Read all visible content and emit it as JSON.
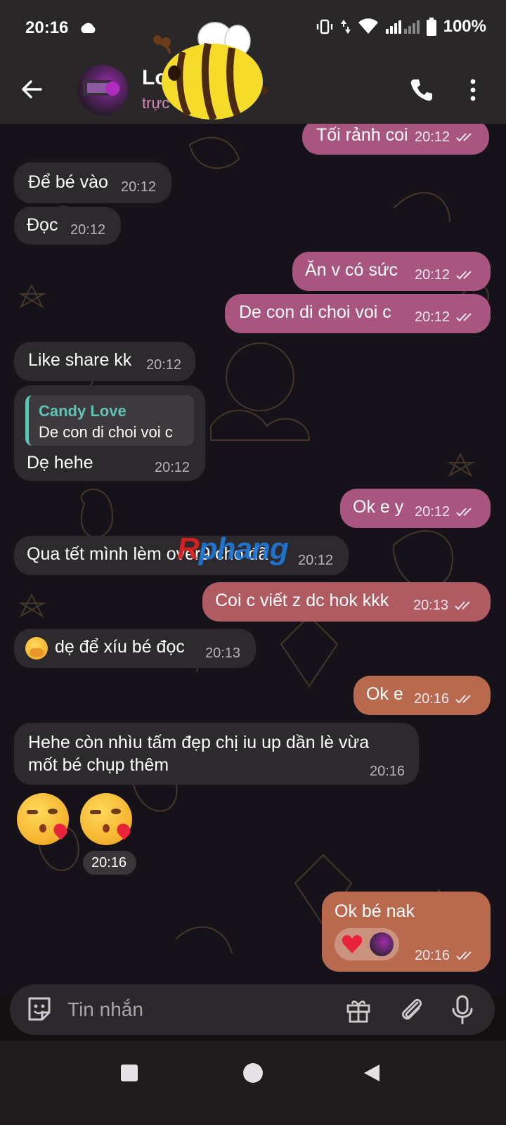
{
  "status_bar": {
    "time": "20:16",
    "battery": "100%"
  },
  "header": {
    "contact_name": "Lo          T",
    "contact_status": "trực"
  },
  "messages": [
    {
      "dir": "out",
      "text": "Tối rảnh coi",
      "time": "20:12"
    },
    {
      "dir": "in",
      "text": "Để bé vào",
      "time": "20:12"
    },
    {
      "dir": "in",
      "text": "Đọc",
      "time": "20:12"
    },
    {
      "dir": "out",
      "text": "Ăn v có sức",
      "time": "20:12"
    },
    {
      "dir": "out",
      "text": "De con di choi voi c",
      "time": "20:12"
    },
    {
      "dir": "in",
      "text": "Like share kk",
      "time": "20:12"
    },
    {
      "dir": "in",
      "reply_name": "Candy Love",
      "reply_text": "De con di choi voi c",
      "text": "Dẹ hehe",
      "time": "20:12"
    },
    {
      "dir": "out",
      "text": "Ok e y",
      "time": "20:12"
    },
    {
      "dir": "in",
      "text": "Qua tết mình lèm over9 cho đã",
      "time": "20:12"
    },
    {
      "dir": "out",
      "text": "Coi c viết z dc hok kkk",
      "time": "20:13"
    },
    {
      "dir": "in",
      "emoji": "hand-over-mouth",
      "text": "dẹ để xíu bé đọc",
      "time": "20:13"
    },
    {
      "dir": "out",
      "text": "Ok e",
      "time": "20:16"
    },
    {
      "dir": "in",
      "text_line1": "Hehe còn nhìu tấm đẹp chị iu up dần lè vừa",
      "text_line2": "mốt bé chụp thêm",
      "time": "20:16"
    },
    {
      "dir": "in",
      "emoji": "face-blowing-a-kiss x2",
      "time": "20:16"
    },
    {
      "dir": "out",
      "text": "Ok bé nak",
      "time": "20:16",
      "reaction": "red-heart"
    }
  ],
  "watermark": {
    "r": "R",
    "rest": "phang"
  },
  "input": {
    "placeholder": "Tin nhắn"
  },
  "colors": {
    "header_bg": "#2a2728",
    "incoming_bubble": "#2d2a2e",
    "outgoing_pink": "#a8557f",
    "outgoing_red": "#b05a62",
    "outgoing_orange": "#b8694e",
    "reply_accent": "#5fc3b5"
  }
}
